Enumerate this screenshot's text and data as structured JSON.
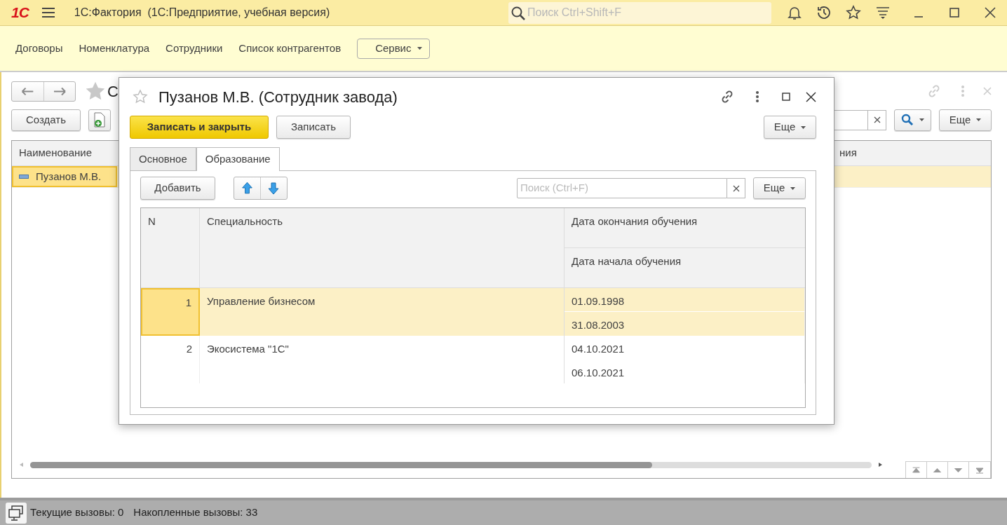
{
  "app": {
    "logo": "1С",
    "title": "1С:Фактория  (1С:Предприятие, учебная версия)",
    "search_placeholder": "Поиск Ctrl+Shift+F"
  },
  "sections": [
    {
      "label": "Договоры"
    },
    {
      "label": "Номенклатура"
    },
    {
      "label": "Сотрудники"
    },
    {
      "label": "Список контрагентов"
    }
  ],
  "service_menu": "Сервис",
  "list_form": {
    "title": "С",
    "create_button": "Создать",
    "more_button": "Еще",
    "columns": [
      "Наименование",
      "ния"
    ],
    "rows": [
      {
        "name": "Пузанов М.В.",
        "selected": true
      }
    ]
  },
  "dialog": {
    "title": "Пузанов М.В. (Сотрудник завода)",
    "save_close_button": "Записать и закрыть",
    "save_button": "Записать",
    "more_button": "Еще",
    "tabs": [
      {
        "label": "Основное",
        "selected": false
      },
      {
        "label": "Образование",
        "selected": true
      }
    ],
    "add_button": "Добавить",
    "search_placeholder": "Поиск (Ctrl+F)",
    "table_more_button": "Еще",
    "table": {
      "columns": {
        "n": "N",
        "specialty": "Специальность",
        "top_date": "Дата окончания обучения",
        "bottom_date": "Дата начала обучения"
      },
      "rows": [
        {
          "n": "1",
          "specialty": "Управление бизнесом",
          "top_date": "01.09.1998",
          "bottom_date": "31.08.2003",
          "selected": true
        },
        {
          "n": "2",
          "specialty": "Экосистема \"1С\"",
          "top_date": "04.10.2021",
          "bottom_date": "06.10.2021",
          "selected": false
        }
      ]
    }
  },
  "status_bar": {
    "current_calls": "Текущие вызовы: 0",
    "total_calls": "Накопленные вызовы: 33"
  }
}
